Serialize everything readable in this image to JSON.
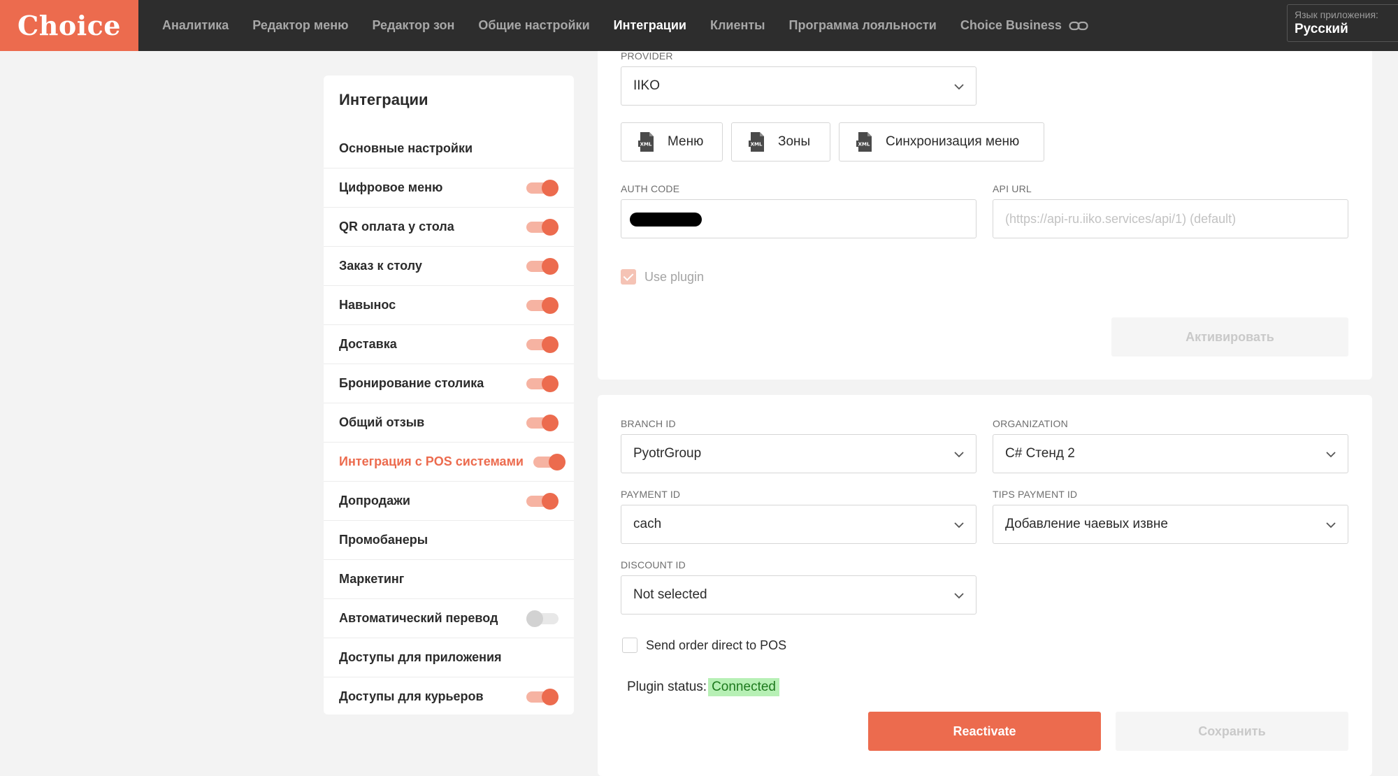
{
  "app": {
    "logo": "Choice"
  },
  "nav": {
    "items": [
      "Аналитика",
      "Редактор меню",
      "Редактор зон",
      "Общие настройки",
      "Интеграции",
      "Клиенты",
      "Программа лояльности",
      "Choice Business"
    ],
    "active": "Интеграции"
  },
  "language": {
    "label": "Язык приложения:",
    "value": "Русский"
  },
  "sidebar": {
    "title": "Интеграции",
    "items": [
      {
        "label": "Основные настройки",
        "toggle": null
      },
      {
        "label": "Цифровое меню",
        "toggle": "on"
      },
      {
        "label": "QR оплата у стола",
        "toggle": "on"
      },
      {
        "label": "Заказ к столу",
        "toggle": "on"
      },
      {
        "label": "Навынос",
        "toggle": "on"
      },
      {
        "label": "Доставка",
        "toggle": "on"
      },
      {
        "label": "Бронирование столика",
        "toggle": "on"
      },
      {
        "label": "Общий отзыв",
        "toggle": "on"
      },
      {
        "label": "Интеграция с POS системами",
        "toggle": "on",
        "active": true
      },
      {
        "label": "Допродажи",
        "toggle": "on"
      },
      {
        "label": "Промобанеры",
        "toggle": null
      },
      {
        "label": "Маркетинг",
        "toggle": null
      },
      {
        "label": "Автоматический перевод",
        "toggle": "off"
      },
      {
        "label": "Доступы для приложения",
        "toggle": null
      },
      {
        "label": "Доступы для курьеров",
        "toggle": "on"
      }
    ]
  },
  "provider": {
    "label": "PROVIDER",
    "value": "IIKO"
  },
  "xml_buttons": [
    "Меню",
    "Зоны",
    "Синхронизация меню"
  ],
  "auth_code": {
    "label": "AUTH CODE"
  },
  "api_url": {
    "label": "API URL",
    "placeholder": "(https://api-ru.iiko.services/api/1) (default)"
  },
  "use_plugin": {
    "label": "Use plugin",
    "checked": true
  },
  "activate_button": "Активировать",
  "branch": {
    "label": "BRANCH ID",
    "value": "PyotrGroup"
  },
  "organization": {
    "label": "ORGANIZATION",
    "value": "C# Стенд 2"
  },
  "payment": {
    "label": "PAYMENT ID",
    "value": "cach"
  },
  "tips_payment": {
    "label": "TIPS PAYMENT ID",
    "value": "Добавление чаевых извне"
  },
  "discount": {
    "label": "DISCOUNT ID",
    "value": "Not selected"
  },
  "send_order": {
    "label": "Send order direct to POS",
    "checked": false
  },
  "plugin_status": {
    "label": "Plugin status:",
    "value": "Connected"
  },
  "reactivate_button": "Reactivate",
  "save_button": "Сохранить",
  "colors": {
    "brand": "#ec6b4e",
    "topbar": "#2d2d2d",
    "status_ok": "#b7f0b5"
  }
}
